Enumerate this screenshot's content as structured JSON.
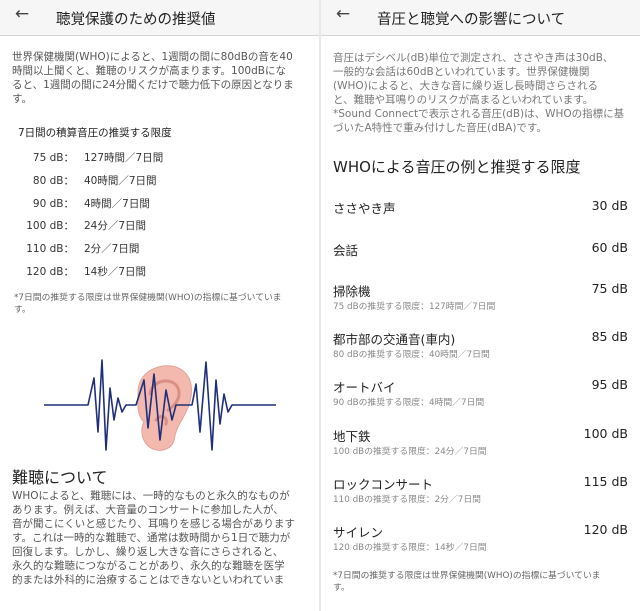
{
  "left": {
    "title": "聴覚保護のための推奨値",
    "intro_lines": [
      "世界保健機関(WHO)によると、1週間の間に80dBの音を40",
      "時間以上聞くと、難聴のリスクが高まります。100dBにな",
      "ると、1週間の間に24分聞くだけで聴力低下の原因となりま",
      "す。"
    ],
    "table_title": "7日間の積算音圧の推奨する限度",
    "limits": [
      {
        "level": "75 dB：",
        "time": "127時間／7日間"
      },
      {
        "level": "80 dB：",
        "time": "40時間／7日間"
      },
      {
        "level": "90 dB：",
        "time": "4時間／7日間"
      },
      {
        "level": "100 dB：",
        "time": "24分／7日間"
      },
      {
        "level": "110 dB：",
        "time": "2分／7日間"
      },
      {
        "level": "120 dB：",
        "time": "14秒／7日間"
      }
    ],
    "note_lines": [
      "*7日間の推奨する限度は世界保健機関(WHO)の指標に基づいていま",
      "す。"
    ],
    "hearing_loss_heading": "難聴について",
    "hearing_loss_lines": [
      "WHOによると、難聴には、一時的なものと永久的なものが",
      "あります。例えば、大音量のコンサートに参加した人が、",
      "音が聞こにくいと感じたり、耳鳴りを感じる場合があります",
      "す。これは一時的な難聴で、通常は数時間から1日で聴力が",
      "回復します。しかし、繰り返し大きな音にさらされると、",
      "永久的な難聴につながることがあり、永久的な難聴を医学",
      "的または外科的に治療することはできないといわれていま"
    ],
    "wave_color": "#1f2f7a",
    "ear_color": "#f3b9ae"
  },
  "right": {
    "title": "音圧と聴覚への影響について",
    "intro_lines": [
      "音圧はデシベル(dB)単位で測定され、ささやき声は30dB、",
      "一般的な会話は60dBといわれています。世界保健機関",
      "(WHO)によると、大きな音に繰り返し長時間さらされる",
      "と、難聴や耳鳴りのリスクが高まるといわれています。",
      "*Sound Connectで表示される音圧(dB)は、WHOの指標に基",
      "づいたA特性で重み付けした音圧(dBA)です。"
    ],
    "examples_heading": "WHOによる音圧の例と推奨する限度",
    "examples": [
      {
        "name": "ささやき声",
        "value": "30 dB",
        "limit": ""
      },
      {
        "name": "会話",
        "value": "60 dB",
        "limit": ""
      },
      {
        "name": "掃除機",
        "value": "75 dB",
        "limit": "75 dBの推奨する限度：127時間／7日間"
      },
      {
        "name": "都市部の交通音(車内)",
        "value": "85 dB",
        "limit": "80 dBの推奨する限度：40時間／7日間"
      },
      {
        "name": "オートバイ",
        "value": "95 dB",
        "limit": "90 dBの推奨する限度：4時間／7日間"
      },
      {
        "name": "地下鉄",
        "value": "100 dB",
        "limit": "100 dBの推奨する限度：24分／7日間"
      },
      {
        "name": "ロックコンサート",
        "value": "115 dB",
        "limit": "110 dBの推奨する限度：2分／7日間"
      },
      {
        "name": "サイレン",
        "value": "120 dB",
        "limit": "120 dBの推奨する限度：14秒／7日間"
      }
    ],
    "note_lines": [
      "*7日間の推奨する限度は世界保健機関(WHO)の指標に基づいていま",
      "す。"
    ]
  },
  "icons": {
    "back": "arrow-back-icon"
  }
}
